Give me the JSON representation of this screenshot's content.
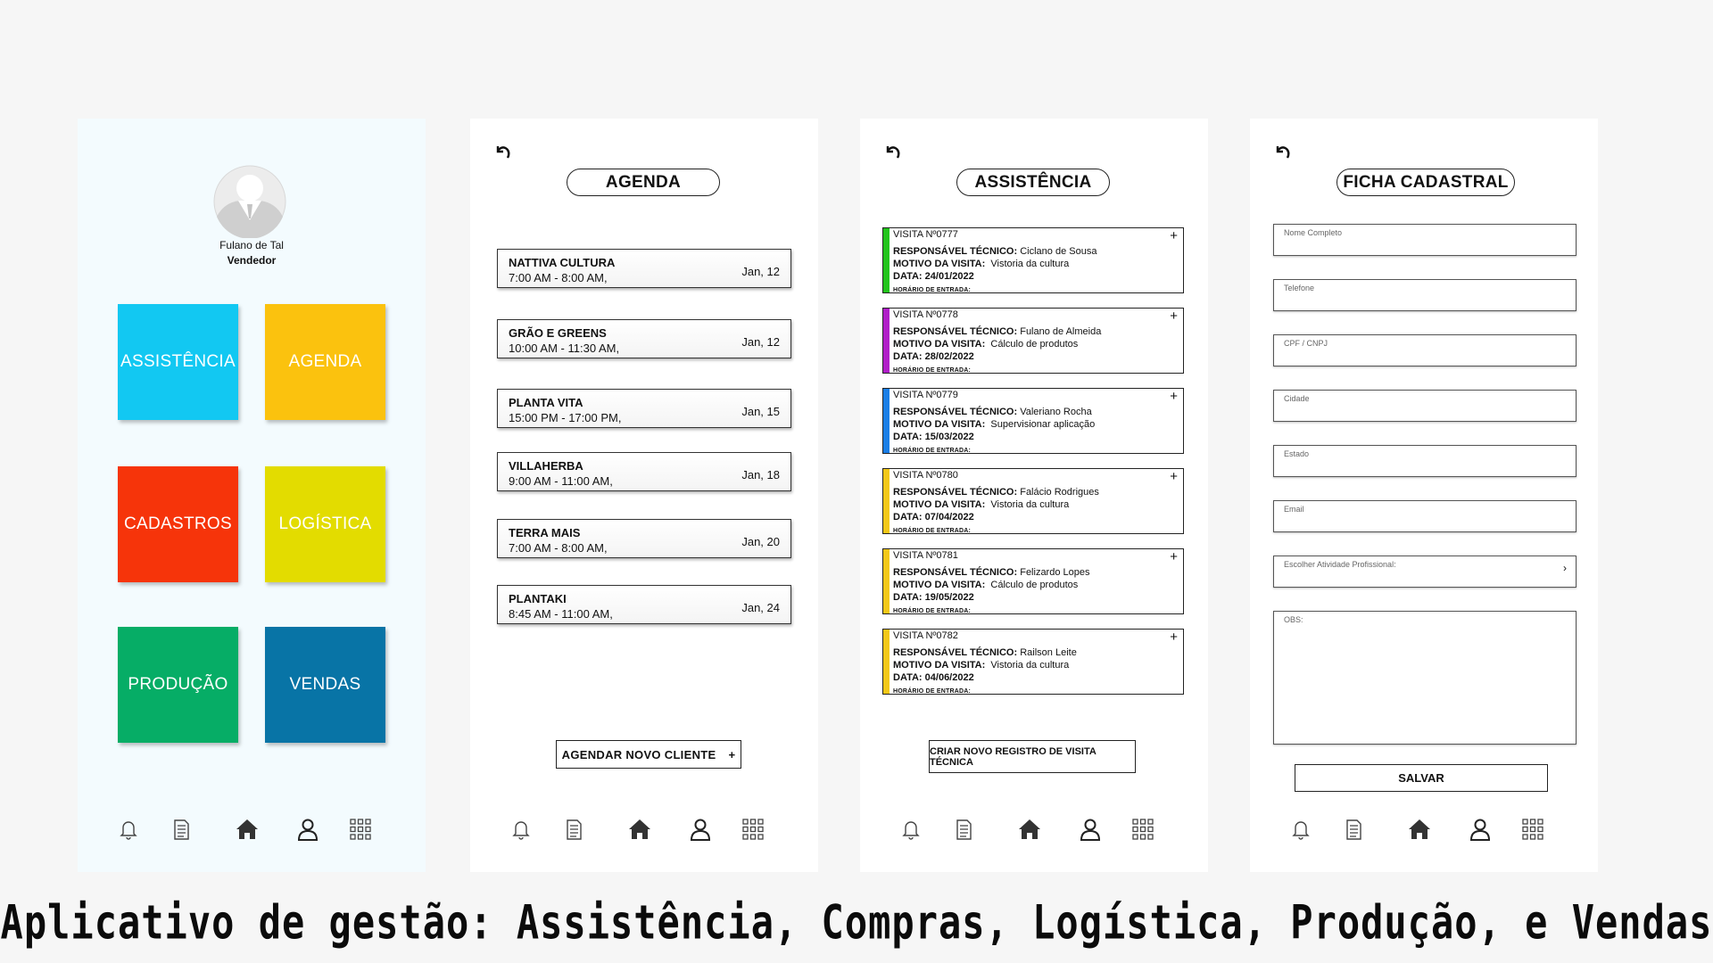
{
  "home": {
    "user_name": "Fulano de Tal",
    "user_role": "Vendedor",
    "tiles": [
      {
        "label": "ASSISTÊNCIA",
        "color": "#12c8f2"
      },
      {
        "label": "AGENDA",
        "color": "#fbc20e"
      },
      {
        "label": "CADASTROS",
        "color": "#f6340a"
      },
      {
        "label": "LOGÍSTICA",
        "color": "#e3dc00"
      },
      {
        "label": "PRODUÇÃO",
        "color": "#06ad66"
      },
      {
        "label": "VENDAS",
        "color": "#0874a6"
      }
    ]
  },
  "agenda": {
    "title": "AGENDA",
    "items": [
      {
        "name": "NATTIVA CULTURA",
        "time": "7:00 AM - 8:00 AM,",
        "date": "Jan, 12"
      },
      {
        "name": "GRÃO E GREENS",
        "time": "10:00 AM - 11:30 AM,",
        "date": "Jan, 12"
      },
      {
        "name": "PLANTA VITA",
        "time": "15:00 PM - 17:00 PM,",
        "date": "Jan, 15"
      },
      {
        "name": "VILLAHERBA",
        "time": "9:00 AM - 11:00 AM,",
        "date": "Jan, 18"
      },
      {
        "name": "TERRA MAIS",
        "time": "7:00 AM - 8:00 AM,",
        "date": "Jan, 20"
      },
      {
        "name": "PLANTAKI",
        "time": "8:45 AM - 11:00 AM,",
        "date": "Jan, 24"
      }
    ],
    "button_label": "AGENDAR NOVO CLIENTE",
    "button_icon": "+"
  },
  "assistencia": {
    "title": "ASSISTÊNCIA",
    "labels": {
      "tech": "RESPONSÁVEL TÉCNICO:",
      "reason": "MOTIVO DA VISITA:",
      "date": "DATA:",
      "entry": "HORÁRIO DE ENTRADA:"
    },
    "visits": [
      {
        "number": "VISITA Nº0777",
        "tech": "Ciclano de Sousa",
        "reason": "Vistoria da cultura",
        "date": "24/01/2022",
        "color": "#22c41c"
      },
      {
        "number": "VISITA Nº0778",
        "tech": "Fulano de Almeida",
        "reason": "Cálculo de produtos",
        "date": "28/02/2022",
        "color": "#b01ec8"
      },
      {
        "number": "VISITA Nº0779",
        "tech": "Valeriano Rocha",
        "reason": "Supervisionar aplicação",
        "date": "15/03/2022",
        "color": "#1a7ee6"
      },
      {
        "number": "VISITA Nº0780",
        "tech": "Falácio Rodrigues",
        "reason": "Vistoria da cultura",
        "date": "07/04/2022",
        "color": "#f2c818"
      },
      {
        "number": "VISITA Nº0781",
        "tech": "Felizardo Lopes",
        "reason": "Cálculo de produtos",
        "date": "19/05/2022",
        "color": "#f2c818"
      },
      {
        "number": "VISITA Nº0782",
        "tech": "Railson Leite",
        "reason": "Vistoria da cultura",
        "date": "04/06/2022",
        "color": "#f2c818"
      }
    ],
    "button_label": "CRIAR NOVO REGISTRO DE VISITA TÉCNICA"
  },
  "ficha": {
    "title": "FICHA CADASTRAL",
    "fields": [
      "Nome Completo",
      "Telefone",
      "CPF / CNPJ",
      "Cidade",
      "Estado",
      "Email"
    ],
    "select_label": "Escolher Atividade Profissional:",
    "obs_label": "OBS:",
    "save_label": "SALVAR"
  },
  "nav_icons": [
    "bell-icon",
    "document-icon",
    "home-icon",
    "user-icon",
    "grid-icon"
  ],
  "caption": "Aplicativo de gestão: Assistência, Compras, Logística, Produção, e Vendas"
}
